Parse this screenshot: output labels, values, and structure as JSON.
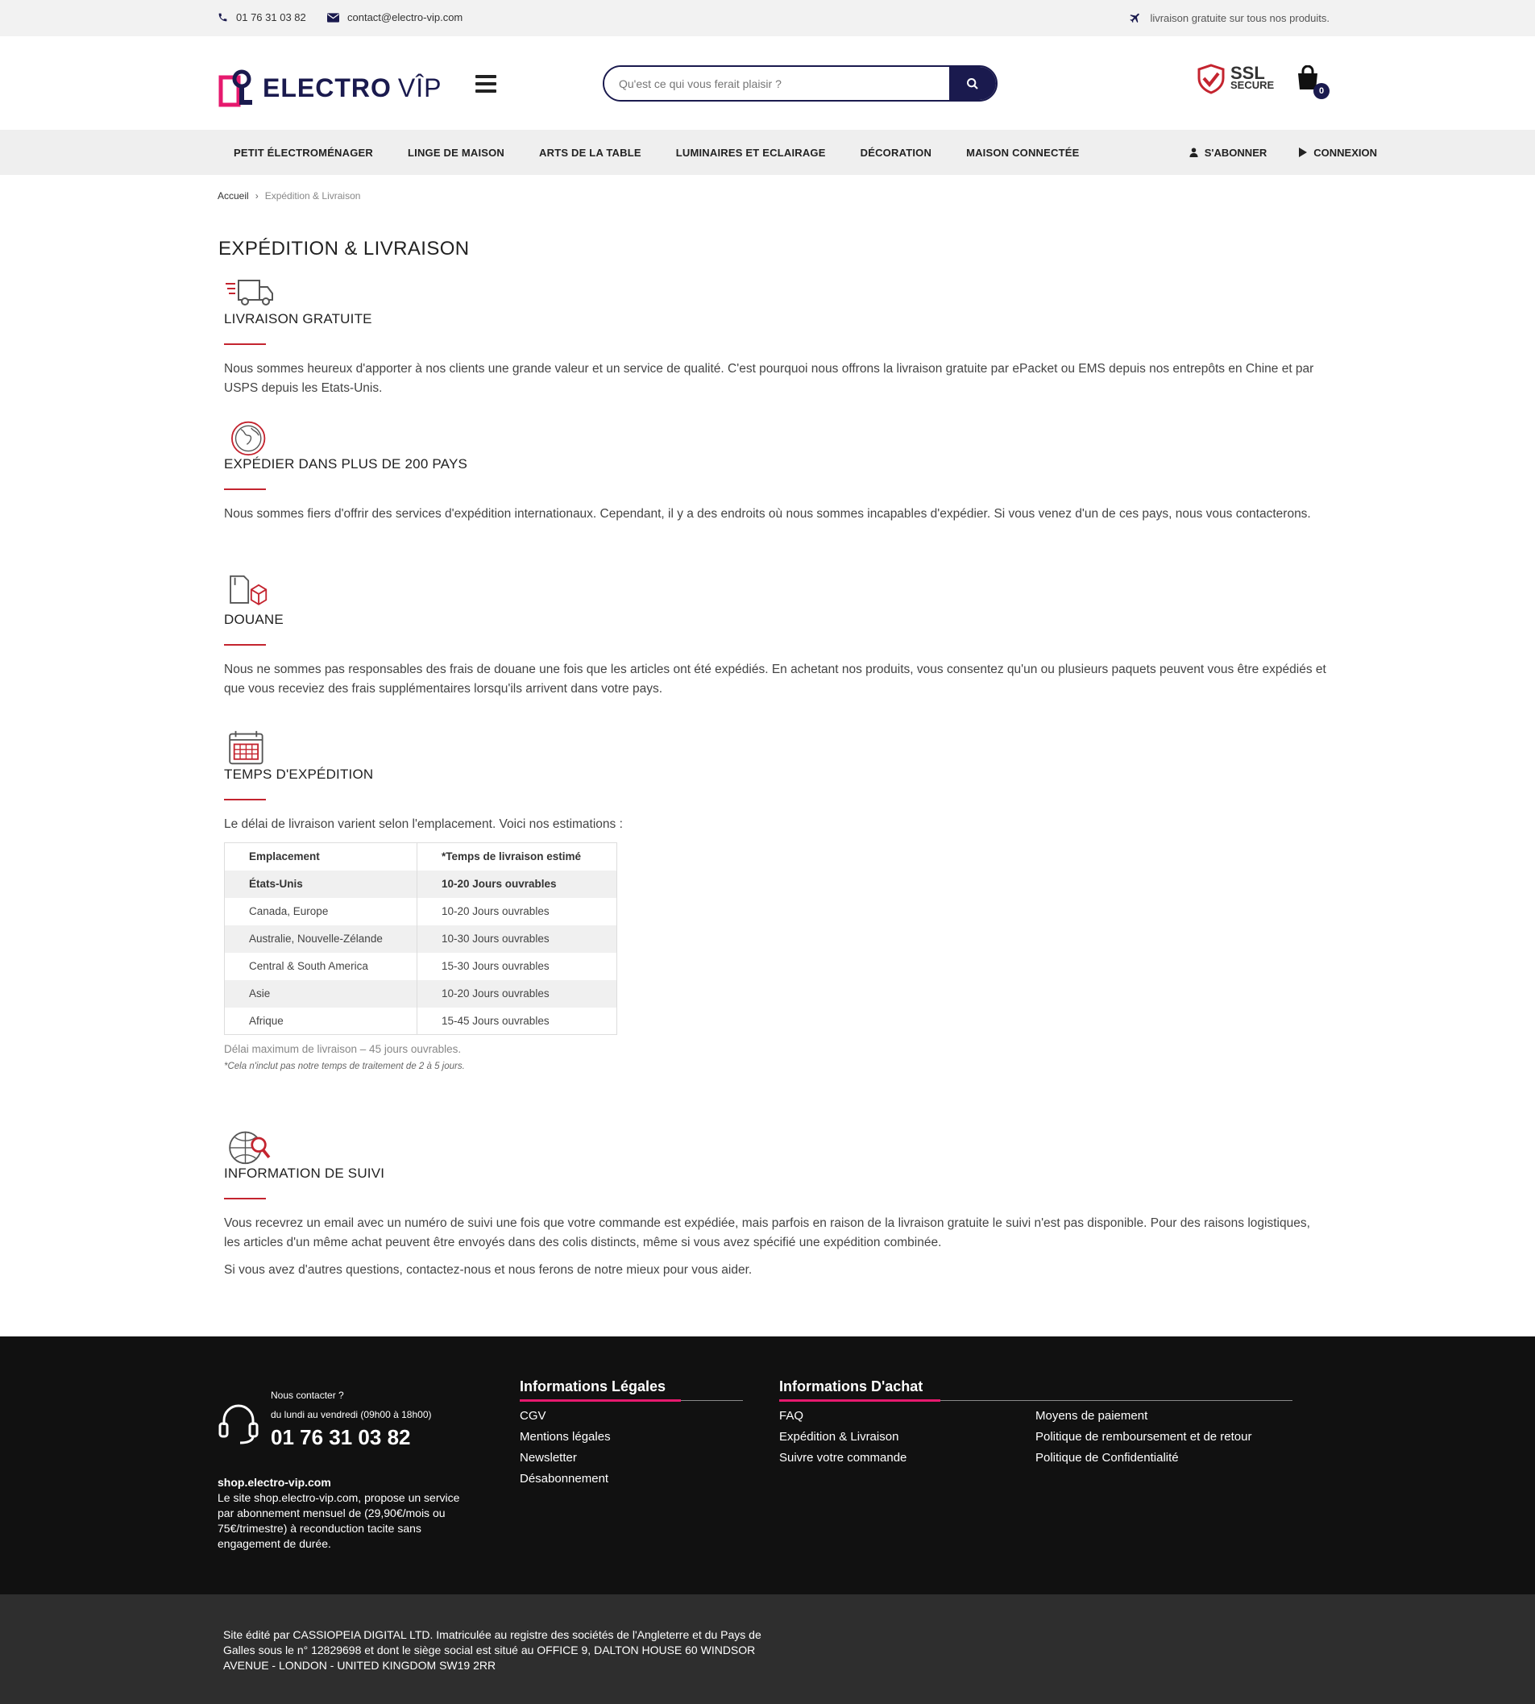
{
  "topbar": {
    "phone": "01 76 31 03 82",
    "email": "contact@electro-vip.com",
    "promo": "livraison gratuite sur tous nos produits."
  },
  "header": {
    "logo_main": "ELECTRO",
    "logo_vip": "VÎP",
    "search_placeholder": "Qu'est ce qui vous ferait plaisir ?",
    "ssl_top": "SSL",
    "ssl_bottom": "SECURE",
    "cart_count": "0"
  },
  "nav": {
    "items": [
      "PETIT ÉLECTROMÉNAGER",
      "LINGE DE MAISON",
      "ARTS DE LA TABLE",
      "LUMINAIRES ET ECLAIRAGE",
      "DÉCORATION",
      "MAISON CONNECTÉE"
    ],
    "subscribe": "S'ABONNER",
    "login": "CONNEXION"
  },
  "breadcrumb": {
    "home": "Accueil",
    "current": "Expédition & Livraison"
  },
  "page_title": "EXPÉDITION & LIVRAISON",
  "sections": [
    {
      "icon": "truck-icon",
      "title": "LIVRAISON GRATUITE",
      "text": "Nous sommes heureux d'apporter à nos clients une grande valeur et un service de qualité. C'est pourquoi nous offrons la livraison gratuite par ePacket ou EMS depuis nos entrepôts en Chine et par USPS depuis les Etats-Unis."
    },
    {
      "icon": "globe-icon",
      "title": "EXPÉDIER DANS PLUS DE 200 PAYS",
      "text": "Nous sommes fiers d'offrir des services d'expédition internationaux. Cependant, il y a des endroits où nous sommes incapables d'expédier. Si vous venez d'un de ces pays, nous vous contacterons."
    },
    {
      "icon": "customs-icon",
      "title": "DOUANE",
      "text": "Nous ne sommes pas responsables des frais de douane une fois que les articles ont été expédiés. En achetant nos produits, vous consentez qu'un ou plusieurs paquets peuvent vous être expédiés et que vous receviez des frais supplémentaires lorsqu'ils arrivent dans votre pays."
    },
    {
      "icon": "calendar-icon",
      "title": "TEMPS D'EXPÉDITION",
      "text": "Le délai de livraison varient selon l'emplacement. Voici nos estimations :"
    },
    {
      "icon": "tracking-icon",
      "title": "INFORMATION DE SUIVI",
      "text": "Vous recevrez un email avec un numéro de suivi une fois que votre commande est expédiée, mais parfois en raison de la livraison gratuite le suivi n'est pas disponible. Pour des raisons logistiques, les articles d'un même achat peuvent être envoyés dans des colis distincts, même si vous avez spécifié une expédition combinée.",
      "text2": "Si vous avez d'autres questions, contactez-nous et nous ferons de notre mieux pour vous aider."
    }
  ],
  "shipping_table": {
    "headers": [
      "Emplacement",
      "*Temps de livraison estimé"
    ],
    "rows": [
      [
        "États-Unis",
        "10-20 Jours ouvrables"
      ],
      [
        "Canada, Europe",
        "10-20 Jours ouvrables"
      ],
      [
        "Australie, Nouvelle-Zélande",
        "10-30 Jours ouvrables"
      ],
      [
        "Central & South America",
        "15-30 Jours ouvrables"
      ],
      [
        "Asie",
        "10-20 Jours ouvrables"
      ],
      [
        "Afrique",
        "15-45 Jours ouvrables"
      ]
    ],
    "note_max": "Délai maximum de livraison – 45 jours ouvrables.",
    "note_processing": "*Cela n'inclut pas notre temps de traitement de 2 à 5 jours."
  },
  "footer": {
    "contact_label": "Nous contacter ?",
    "hours": "du lundi au vendredi (09h00 à 18h00)",
    "phone": "01 76 31 03 82",
    "site_name": "shop.electro-vip.com",
    "about": "Le site shop.electro-vip.com, propose un service par abonnement mensuel de (29,90€/mois ou 75€/trimestre) à reconduction tacite sans engagement de durée.",
    "legal_title": "Informations Légales",
    "legal_links": [
      "CGV",
      "Mentions légales",
      "Newsletter",
      "Désabonnement"
    ],
    "purchase_title": "Informations D'achat",
    "purchase_links_a": [
      "FAQ",
      "Expédition & Livraison",
      "Suivre votre commande"
    ],
    "purchase_links_b": [
      "Moyens de paiement",
      "Politique de remboursement et de retour",
      "Politique de Confidentialité"
    ],
    "company": "Site édité par CASSIOPEIA DIGITAL LTD. Imatriculée au registre des sociétés de l'Angleterre et du Pays de Galles sous le n° 12829698 et dont le siège social est situé au OFFICE 9, DALTON HOUSE 60 WINDSOR AVENUE - LONDON - UNITED KINGDOM SW19 2RR"
  },
  "colors": {
    "brand_navy": "#1a1a4e",
    "accent_red": "#c4242f",
    "accent_pink": "#e6196e"
  }
}
